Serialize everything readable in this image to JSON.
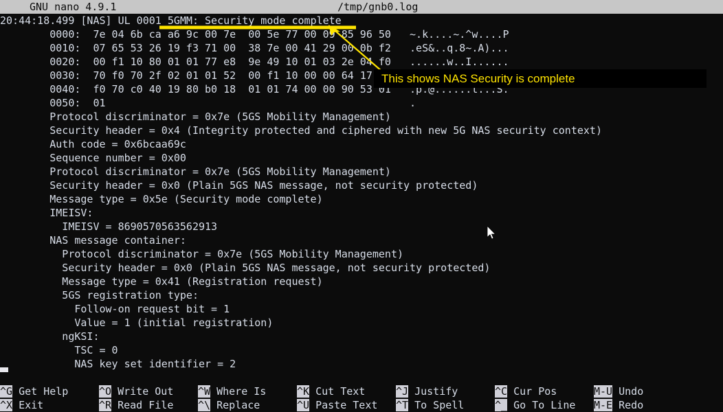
{
  "titlebar": {
    "version": "GNU nano 4.9.1",
    "filename": "/tmp/gnb0.log"
  },
  "editor": {
    "lines": [
      "20:44:18.499 [NAS] UL 0001 5GMM: Security mode complete",
      "        0000:  7e 04 6b ca a6 9c 00 7e  00 5e 77 00 09 85 96 50   ~.k....~.^w....P",
      "        0010:  07 65 53 26 19 f3 71 00  38 7e 00 41 29 00 0b f2   .eS&..q.8~.A)...",
      "        0020:  00 f1 10 80 01 01 77 e8  9e 49 10 01 03 2e 04 f0   ......w..I......",
      "        0030:  70 f0 70 2f 02 01 01 52  00 f1 10 00 00 64 17 f0   .p.@......t...S.",
      "        0040:  f0 70 c0 40 19 80 b0 18  01 01 74 00 00 90 53 01   .p.@......t...S.",
      "        0050:  01                                                 .",
      "        Protocol discriminator = 0x7e (5GS Mobility Management)",
      "        Security header = 0x4 (Integrity protected and ciphered with new 5G NAS security context)",
      "        Auth code = 0x6bcaa69c",
      "        Sequence number = 0x00",
      "        Protocol discriminator = 0x7e (5GS Mobility Management)",
      "        Security header = 0x0 (Plain 5GS NAS message, not security protected)",
      "        Message type = 0x5e (Security mode complete)",
      "        IMEISV:",
      "          IMEISV = 8690570563562913",
      "        NAS message container:",
      "          Protocol discriminator = 0x7e (5GS Mobility Management)",
      "          Security header = 0x0 (Plain 5GS NAS message, not security protected)",
      "          Message type = 0x41 (Registration request)",
      "          5GS registration type:",
      "            Follow-on request bit = 1",
      "            Value = 1 (initial registration)",
      "          ngKSI:",
      "            TSC = 0",
      "            NAS key set identifier = 2"
    ]
  },
  "annotation": {
    "tooltip_text": "This shows NAS Security is complete",
    "highlight_color": "#ffe400",
    "tooltip_bg": "#000000",
    "underline_target": "5GMM: Security mode complete"
  },
  "shortcutbar": {
    "row1": [
      {
        "key": "^G",
        "label": "Get Help"
      },
      {
        "key": "^O",
        "label": "Write Out"
      },
      {
        "key": "^W",
        "label": "Where Is"
      },
      {
        "key": "^K",
        "label": "Cut Text"
      },
      {
        "key": "^J",
        "label": "Justify"
      },
      {
        "key": "^C",
        "label": "Cur Pos"
      },
      {
        "key": "M-U",
        "label": "Undo"
      }
    ],
    "row2": [
      {
        "key": "^X",
        "label": "Exit"
      },
      {
        "key": "^R",
        "label": "Read File"
      },
      {
        "key": "^\\",
        "label": "Replace"
      },
      {
        "key": "^U",
        "label": "Paste Text"
      },
      {
        "key": "^T",
        "label": "To Spell"
      },
      {
        "key": "^_",
        "label": "Go To Line"
      },
      {
        "key": "M-E",
        "label": "Redo"
      }
    ]
  }
}
